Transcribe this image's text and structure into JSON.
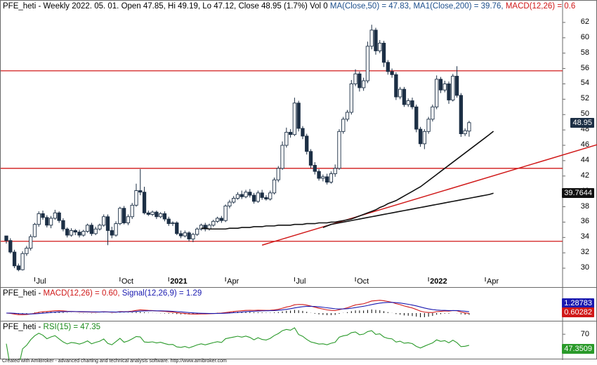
{
  "header": {
    "symbol": "PFE_heti",
    "info": "- Weekly 2022. 05. 01. Open 47.85, Hi 49.19, Lo 47.12, Close 48.95 (1.7%) Vol 0",
    "ma50": "MA(Close,50) = 47.83,",
    "ma200": "MA1(Close,200) = 39.76,",
    "macd_tail": "MACD(12,26) = 0.6"
  },
  "macd_header": {
    "symbol": "PFE_heti",
    "macd": "MACD(12,26) = 0.60,",
    "signal": "Signal(12,26,9) = 1.29"
  },
  "rsi_header": {
    "symbol": "PFE_heti",
    "rsi": "RSI(15) = 47.35"
  },
  "price_axis": {
    "ticks": [
      "62",
      "60",
      "58",
      "56",
      "54",
      "52",
      "50",
      "48",
      "46",
      "44",
      "42",
      "40",
      "38",
      "36",
      "34",
      "32",
      "30"
    ],
    "last_close_tag": "48.95",
    "ma200_tag": "39.7644"
  },
  "macd_axis": {
    "signal_tag": "1.28783",
    "macd_tag": "0.60282"
  },
  "rsi_axis": {
    "tick": "70",
    "rsi_tag": "47.3509"
  },
  "time_axis": [
    "Jul",
    "Oct",
    "2021",
    "Apr",
    "Jul",
    "Oct",
    "2022",
    "Apr"
  ],
  "footer": "Created with AmiBroker - advanced charting and technical analysis software. http://www.amibroker.com",
  "colors": {
    "up": "#ffffff",
    "down": "#1c2f45",
    "ma": "#111111",
    "resistance": "#d01818",
    "macd": "#d01818",
    "signal": "#1a1ab0",
    "rsi": "#2a9a2a",
    "close_tag": "#1c2f45",
    "ma200_tag": "#111111",
    "signal_tag": "#1a1ab0",
    "macd_tag": "#d01818",
    "rsi_tag": "#2a9a2a"
  },
  "chart_data": {
    "type": "candlestick",
    "title": "PFE_heti",
    "ylim": [
      29,
      63
    ],
    "horizontal_lines": [
      55.7,
      43.0,
      33.5
    ],
    "trendline": {
      "from": {
        "week": 63,
        "price": 33.0
      },
      "to": {
        "week": 169,
        "price": 49.8
      }
    },
    "candles": [
      [
        34.2,
        33.6,
        34.2,
        33.2
      ],
      [
        33.6,
        32.1,
        33.9,
        31.9
      ],
      [
        32.1,
        30.3,
        32.4,
        30.0
      ],
      [
        30.3,
        29.8,
        30.6,
        29.6
      ],
      [
        29.8,
        31.9,
        32.2,
        29.7
      ],
      [
        31.9,
        32.6,
        32.9,
        31.6
      ],
      [
        32.6,
        34.1,
        34.4,
        32.3
      ],
      [
        34.1,
        35.7,
        35.9,
        34.0
      ],
      [
        35.7,
        37.1,
        37.4,
        35.4
      ],
      [
        37.1,
        36.6,
        37.5,
        36.3
      ],
      [
        36.6,
        35.6,
        36.9,
        35.3
      ],
      [
        35.6,
        36.5,
        36.8,
        35.2
      ],
      [
        36.5,
        37.2,
        37.6,
        36.3
      ],
      [
        37.2,
        36.2,
        37.4,
        35.9
      ],
      [
        36.2,
        35.1,
        36.5,
        34.8
      ],
      [
        35.1,
        34.3,
        35.3,
        34.0
      ],
      [
        34.3,
        34.9,
        35.2,
        34.1
      ],
      [
        34.9,
        34.7,
        35.1,
        34.3
      ],
      [
        34.7,
        34.3,
        35.0,
        34.0
      ],
      [
        34.3,
        34.8,
        35.0,
        34.1
      ],
      [
        34.8,
        35.6,
        35.8,
        34.6
      ],
      [
        35.6,
        34.5,
        35.9,
        34.2
      ],
      [
        34.5,
        35.1,
        35.4,
        34.3
      ],
      [
        35.1,
        35.6,
        35.8,
        34.9
      ],
      [
        35.6,
        36.7,
        37.0,
        35.4
      ],
      [
        36.7,
        34.9,
        37.0,
        33.0
      ],
      [
        34.9,
        34.3,
        35.4,
        33.9
      ],
      [
        34.3,
        35.8,
        36.1,
        34.1
      ],
      [
        35.8,
        37.8,
        38.0,
        35.6
      ],
      [
        37.8,
        35.9,
        38.1,
        35.7
      ],
      [
        35.9,
        36.7,
        37.0,
        35.6
      ],
      [
        36.7,
        38.2,
        38.5,
        36.4
      ],
      [
        38.2,
        40.1,
        41.0,
        38.0
      ],
      [
        40.1,
        39.9,
        42.9,
        39.5
      ],
      [
        39.9,
        37.2,
        40.6,
        37.0
      ],
      [
        37.2,
        37.0,
        37.5,
        36.8
      ],
      [
        37.0,
        37.3,
        37.5,
        36.8
      ],
      [
        37.3,
        36.7,
        37.5,
        36.4
      ],
      [
        36.7,
        37.1,
        37.3,
        36.5
      ],
      [
        37.1,
        36.4,
        37.4,
        36.1
      ],
      [
        36.4,
        35.8,
        36.7,
        35.5
      ],
      [
        35.8,
        35.9,
        36.1,
        35.5
      ],
      [
        35.9,
        34.5,
        36.1,
        34.3
      ],
      [
        34.5,
        34.2,
        34.9,
        33.9
      ],
      [
        34.2,
        34.6,
        34.9,
        34.0
      ],
      [
        34.6,
        33.8,
        34.8,
        33.5
      ],
      [
        33.8,
        34.4,
        34.6,
        33.4
      ],
      [
        34.4,
        35.1,
        35.3,
        34.2
      ],
      [
        35.1,
        35.6,
        35.8,
        34.9
      ],
      [
        35.6,
        35.1,
        35.9,
        34.8
      ],
      [
        35.1,
        35.6,
        35.8,
        34.9
      ],
      [
        35.6,
        36.1,
        36.3,
        35.4
      ],
      [
        36.1,
        36.5,
        36.7,
        35.9
      ],
      [
        36.5,
        36.2,
        36.8,
        35.9
      ],
      [
        36.2,
        38.1,
        38.3,
        36.0
      ],
      [
        38.1,
        38.6,
        38.9,
        37.8
      ],
      [
        38.6,
        39.1,
        39.4,
        38.4
      ],
      [
        39.1,
        39.6,
        39.9,
        38.9
      ],
      [
        39.6,
        39.3,
        40.1,
        39.0
      ],
      [
        39.3,
        39.9,
        40.2,
        39.1
      ],
      [
        39.9,
        39.5,
        40.3,
        39.2
      ],
      [
        39.5,
        38.7,
        39.8,
        38.4
      ],
      [
        38.7,
        39.8,
        40.1,
        38.5
      ],
      [
        39.8,
        39.2,
        40.2,
        38.9
      ],
      [
        39.2,
        39.0,
        39.5,
        38.8
      ],
      [
        39.0,
        39.8,
        40.1,
        38.8
      ],
      [
        39.8,
        41.5,
        41.8,
        39.6
      ],
      [
        41.5,
        43.0,
        43.3,
        41.2
      ],
      [
        43.0,
        46.0,
        46.5,
        42.8
      ],
      [
        46.0,
        47.7,
        48.3,
        45.7
      ],
      [
        47.7,
        47.4,
        48.1,
        47.0
      ],
      [
        47.4,
        51.5,
        52.2,
        47.2
      ],
      [
        51.5,
        48.2,
        51.8,
        47.8
      ],
      [
        48.2,
        47.2,
        48.5,
        46.8
      ],
      [
        47.2,
        45.2,
        47.5,
        44.8
      ],
      [
        45.2,
        43.4,
        45.5,
        43.0
      ],
      [
        43.4,
        42.6,
        43.8,
        42.2
      ],
      [
        42.6,
        41.7,
        42.9,
        41.4
      ],
      [
        41.7,
        41.9,
        42.2,
        41.3
      ],
      [
        41.9,
        41.2,
        42.3,
        40.9
      ],
      [
        41.2,
        42.3,
        42.6,
        41.0
      ],
      [
        42.3,
        43.0,
        43.5,
        41.9
      ],
      [
        43.0,
        47.8,
        48.1,
        42.8
      ],
      [
        47.8,
        49.4,
        49.7,
        47.5
      ],
      [
        49.4,
        50.3,
        50.6,
        49.1
      ],
      [
        50.3,
        54.0,
        54.5,
        50.0
      ],
      [
        54.0,
        55.3,
        55.9,
        53.7
      ],
      [
        55.3,
        53.5,
        55.6,
        53.0
      ],
      [
        53.5,
        54.4,
        54.8,
        53.1
      ],
      [
        54.4,
        58.9,
        59.5,
        54.1
      ],
      [
        58.9,
        61.0,
        61.7,
        58.5
      ],
      [
        61.0,
        58.3,
        61.3,
        57.8
      ],
      [
        58.3,
        59.3,
        59.7,
        58.0
      ],
      [
        59.3,
        56.8,
        59.6,
        56.2
      ],
      [
        56.8,
        55.6,
        57.1,
        55.2
      ],
      [
        55.6,
        55.2,
        56.0,
        54.8
      ],
      [
        55.2,
        52.3,
        55.5,
        51.9
      ],
      [
        52.3,
        53.3,
        53.6,
        52.0
      ],
      [
        53.3,
        51.3,
        53.6,
        51.0
      ],
      [
        51.3,
        51.8,
        52.1,
        51.0
      ],
      [
        51.8,
        51.0,
        52.2,
        50.7
      ],
      [
        51.0,
        48.1,
        51.3,
        47.7
      ],
      [
        48.1,
        46.2,
        48.4,
        45.8
      ],
      [
        46.2,
        47.8,
        48.1,
        45.5
      ],
      [
        47.8,
        49.4,
        49.7,
        47.5
      ],
      [
        49.4,
        51.0,
        51.3,
        49.1
      ],
      [
        51.0,
        54.6,
        55.1,
        50.7
      ],
      [
        54.6,
        53.2,
        54.9,
        52.8
      ],
      [
        53.2,
        54.0,
        54.4,
        52.9
      ],
      [
        54.0,
        51.9,
        54.3,
        51.4
      ],
      [
        51.9,
        55.0,
        55.3,
        51.7
      ],
      [
        55.0,
        52.5,
        56.3,
        52.2
      ],
      [
        52.5,
        47.5,
        52.8,
        47.1
      ],
      [
        47.5,
        47.9,
        48.2,
        47.2
      ],
      [
        47.85,
        48.95,
        49.19,
        47.12
      ]
    ],
    "ma50": [
      35.2,
      35.2,
      35.1,
      35.1,
      35.1,
      35.1,
      35.1,
      35.2,
      35.2,
      35.2,
      35.3,
      35.3,
      35.3,
      35.4,
      35.4,
      35.4,
      35.5,
      35.5,
      35.5,
      35.6,
      35.6,
      35.6,
      35.6,
      35.7,
      35.7,
      35.7,
      35.8,
      35.8,
      35.8,
      35.9,
      35.9,
      35.9,
      36.0,
      36.0,
      36.1,
      36.2,
      36.3,
      36.4,
      36.6,
      36.8,
      37.0,
      37.2,
      37.4,
      37.6,
      37.9,
      38.1,
      38.4,
      38.6,
      38.8,
      39.1,
      39.4,
      39.7,
      40.0,
      40.3,
      40.6,
      41.0,
      41.4,
      41.8,
      42.2,
      42.6,
      43.0,
      43.4,
      43.8,
      44.2,
      44.6,
      45.0,
      45.4,
      45.8,
      46.2,
      46.6,
      47.0,
      47.4,
      47.83
    ],
    "ma50_start_week": 48,
    "ma200": [
      35.3,
      35.5,
      35.7,
      35.8,
      35.9,
      36.0,
      36.1,
      36.2,
      36.3,
      36.4,
      36.5,
      36.6,
      36.7,
      36.8,
      36.9,
      37.0,
      37.1,
      37.2,
      37.3,
      37.4,
      37.5,
      37.6,
      37.7,
      37.8,
      37.9,
      38.0,
      38.1,
      38.2,
      38.3,
      38.4,
      38.5,
      38.6,
      38.7,
      38.8,
      38.9,
      39.0,
      39.1,
      39.2,
      39.3,
      39.4,
      39.5,
      39.6,
      39.76
    ],
    "ma200_start_week": 78,
    "macd": {
      "ylim": [
        -2.5,
        5.5
      ],
      "macd_last": 0.6,
      "signal_last": 1.29
    },
    "rsi": {
      "ylim": [
        20,
        85
      ],
      "levels": [
        70
      ],
      "last": 47.35
    }
  }
}
